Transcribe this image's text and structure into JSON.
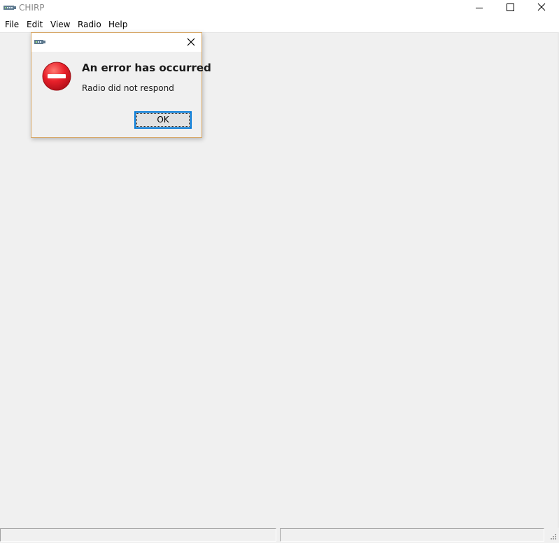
{
  "window": {
    "title": "CHIRP",
    "app_icon": "radio-app-icon",
    "controls": [
      "minimize-icon",
      "maximize-icon",
      "close-icon"
    ]
  },
  "menubar": {
    "items": [
      {
        "label": "File"
      },
      {
        "label": "Edit"
      },
      {
        "label": "View"
      },
      {
        "label": "Radio"
      },
      {
        "label": "Help"
      }
    ]
  },
  "dialog": {
    "title": "",
    "icon": "error-icon",
    "heading": "An error has occurred",
    "message": "Radio did not respond",
    "ok_label": "OK",
    "close_icon": "close-icon"
  },
  "colors": {
    "accent": "#0078d7",
    "error_red": "#e8202a",
    "dialog_border": "#d7a868",
    "window_bg": "#f0f0f0"
  }
}
